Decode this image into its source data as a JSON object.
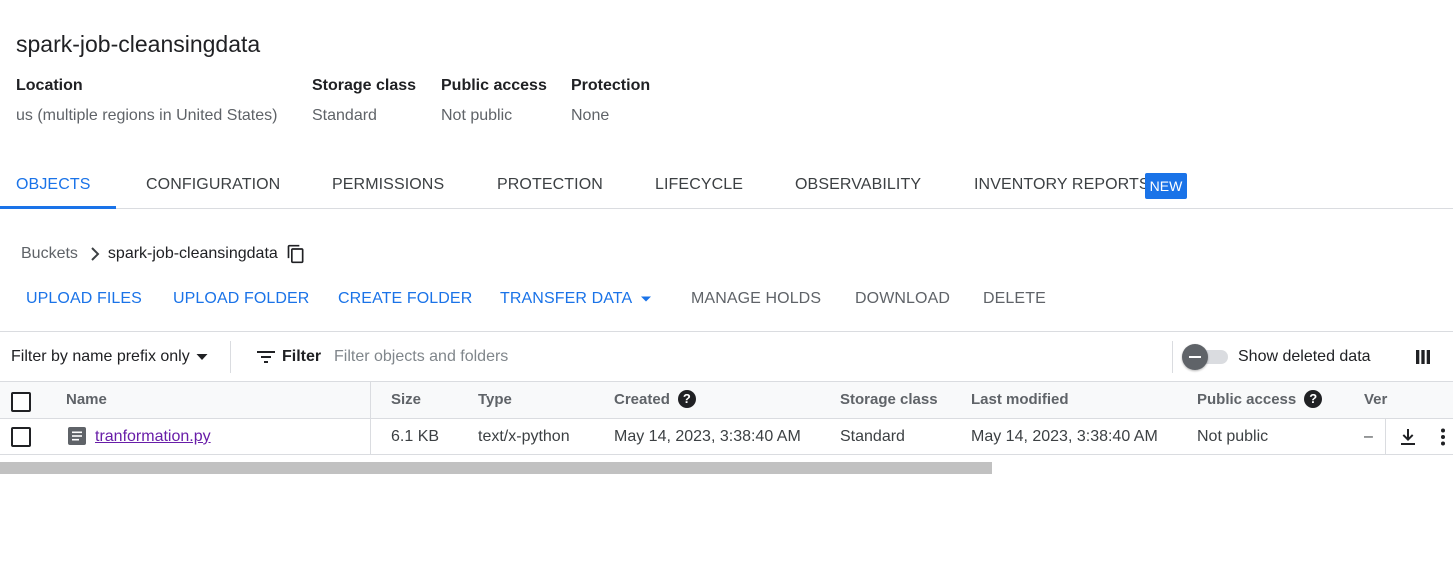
{
  "bucket": {
    "title": "spark-job-cleansingdata",
    "meta": [
      {
        "label": "Location",
        "value": "us (multiple regions in United States)"
      },
      {
        "label": "Storage class",
        "value": "Standard"
      },
      {
        "label": "Public access",
        "value": "Not public"
      },
      {
        "label": "Protection",
        "value": "None"
      }
    ]
  },
  "tabs": [
    {
      "label": "OBJECTS",
      "active": true
    },
    {
      "label": "CONFIGURATION"
    },
    {
      "label": "PERMISSIONS"
    },
    {
      "label": "PROTECTION"
    },
    {
      "label": "LIFECYCLE"
    },
    {
      "label": "OBSERVABILITY"
    },
    {
      "label": "INVENTORY REPORTS",
      "badge": "NEW"
    }
  ],
  "breadcrumb": {
    "root": "Buckets",
    "current": "spark-job-cleansingdata"
  },
  "actions": [
    {
      "label": "UPLOAD FILES",
      "enabled": true
    },
    {
      "label": "UPLOAD FOLDER",
      "enabled": true
    },
    {
      "label": "CREATE FOLDER",
      "enabled": true
    },
    {
      "label": "TRANSFER DATA",
      "enabled": true,
      "dropdown": true
    },
    {
      "label": "MANAGE HOLDS",
      "enabled": false
    },
    {
      "label": "DOWNLOAD",
      "enabled": false
    },
    {
      "label": "DELETE",
      "enabled": false
    }
  ],
  "filterbar": {
    "prefix_select": "Filter by name prefix only",
    "filter_label": "Filter",
    "placeholder": "Filter objects and folders",
    "toggle_label": "Show deleted data",
    "toggle_on": false
  },
  "table": {
    "columns": [
      "Name",
      "Size",
      "Type",
      "Created",
      "Storage class",
      "Last modified",
      "Public access",
      "Ver"
    ],
    "rows": [
      {
        "name": "tranformation.py",
        "size": "6.1 KB",
        "type": "text/x-python",
        "created": "May 14, 2023, 3:38:40 AM",
        "storage_class": "Standard",
        "last_modified": "May 14, 2023, 3:38:40 AM",
        "public_access": "Not public",
        "version": "–"
      }
    ]
  },
  "colors": {
    "accent": "#1a73e8",
    "visited_link": "#681da8",
    "disabled_text": "#5f6368",
    "divider": "#dadce0"
  },
  "icons": [
    "chevron-right-icon",
    "copy-icon",
    "arrow-drop-down-icon",
    "filter-list-icon",
    "help-icon",
    "file-icon",
    "download-icon",
    "more-vert-icon",
    "column-display-icon"
  ]
}
